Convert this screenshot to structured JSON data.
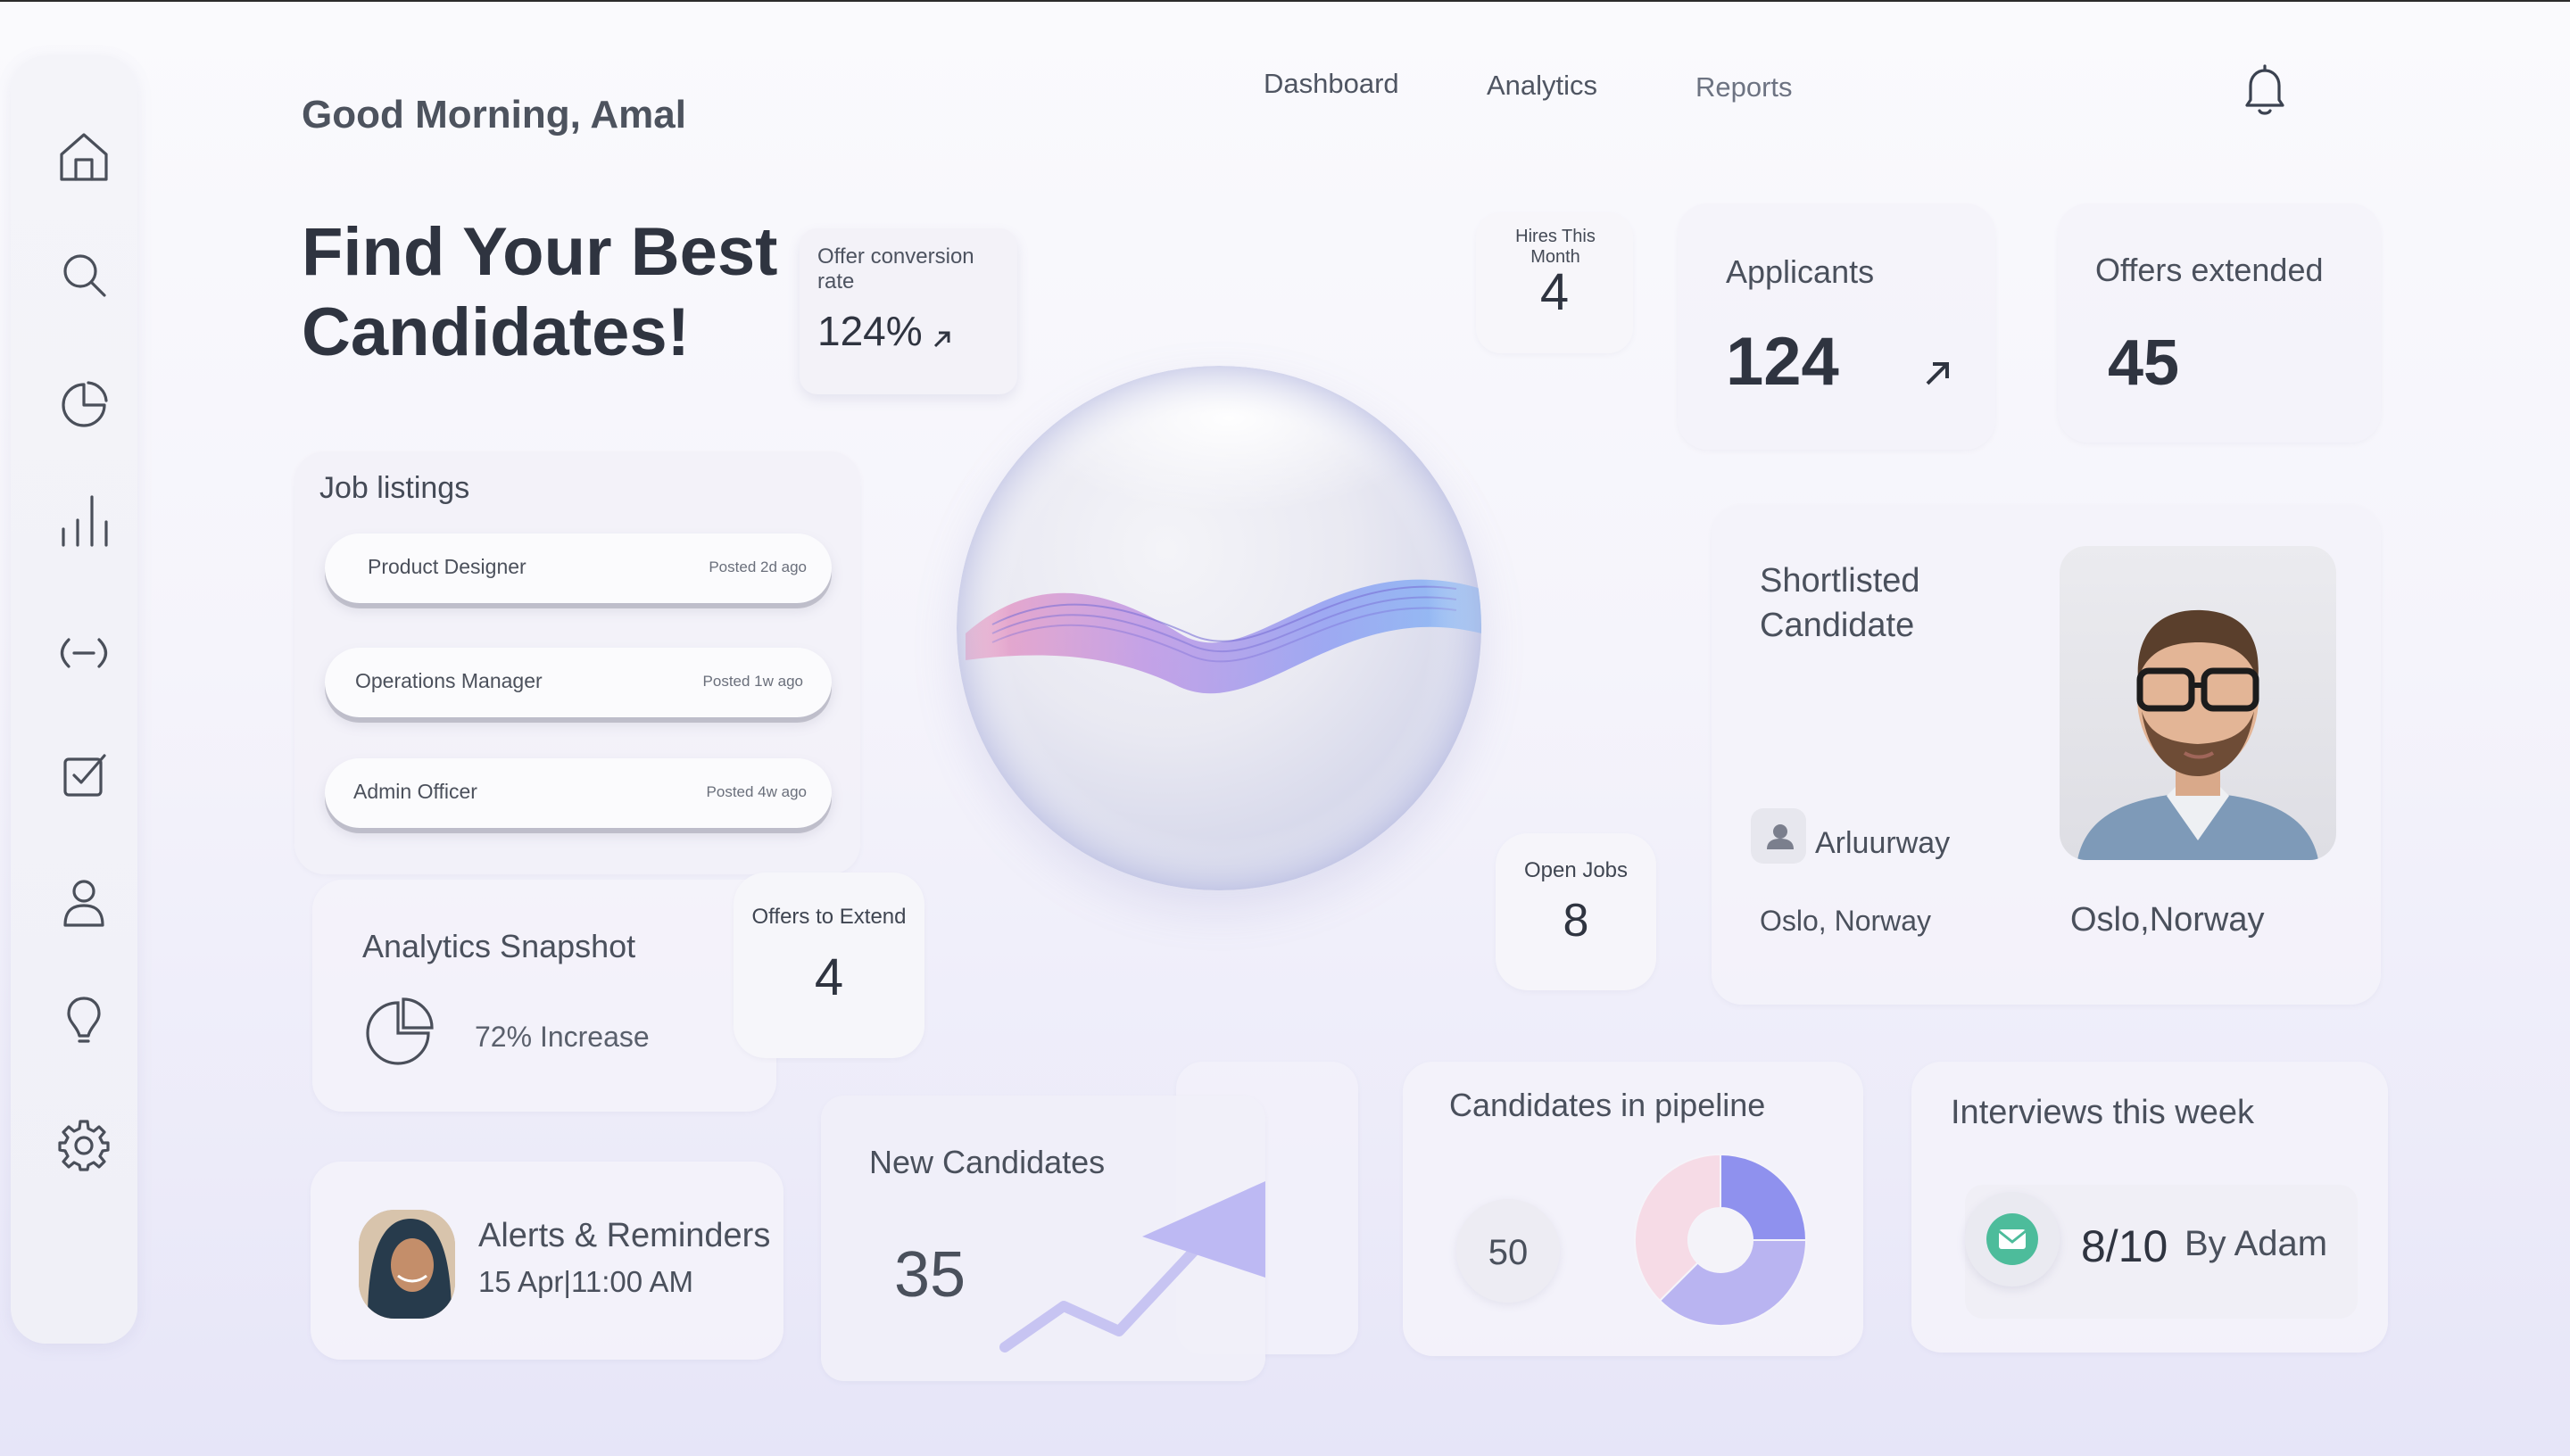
{
  "greeting": "Good Morning, Amal",
  "nav": {
    "items": [
      "Dashboard",
      "Analytics",
      "Reports"
    ]
  },
  "headline": {
    "line1": "Find Your Best",
    "line2": "Candidates!"
  },
  "offer_conversion": {
    "label": "Offer conversion rate",
    "value": "124%"
  },
  "hires_this_month": {
    "label": "Hires This Month",
    "value": "4"
  },
  "applicants": {
    "label": "Applicants",
    "value": "124"
  },
  "offers_extended": {
    "label": "Offers extended",
    "value": "45"
  },
  "job_listings": {
    "title": "Job listings",
    "items": [
      {
        "title": "Product Designer",
        "posted": "Posted 2d ago"
      },
      {
        "title": "Operations Manager",
        "posted": "Posted 1w ago"
      },
      {
        "title": "Admin Officer",
        "posted": "Posted 4w ago"
      }
    ]
  },
  "shortlisted": {
    "title_line1": "Shortlisted",
    "title_line2": "Candidate",
    "name": "Arluurway",
    "location_left": "Oslo, Norway",
    "location_right": "Oslo,Norway"
  },
  "open_jobs": {
    "label": "Open Jobs",
    "value": "8"
  },
  "analytics_snapshot": {
    "title": "Analytics Snapshot",
    "increase": "72% Increase"
  },
  "offers_to_extend": {
    "label": "Offers to Extend",
    "value": "4"
  },
  "alerts": {
    "title": "Alerts & Reminders",
    "datetime": "15 Apr|11:00 AM"
  },
  "new_candidates": {
    "title": "New Candidates",
    "value": "35"
  },
  "pipeline": {
    "title": "Candidates in pipeline",
    "count": "50",
    "chart_data": {
      "type": "pie",
      "segments": [
        {
          "fraction": 0.25,
          "color": "#8f91ee"
        },
        {
          "fraction": 0.375,
          "color": "#b9b4f1"
        },
        {
          "fraction": 0.375,
          "color": "#f6dbe6"
        }
      ]
    }
  },
  "interviews": {
    "title": "Interviews this week",
    "value": "8/10",
    "by": "By Adam"
  },
  "colors": {
    "accent": "#8f91ee",
    "text_dark": "#2f3440",
    "mail_icon": "#4dbc9b"
  },
  "icons": {
    "sidebar": [
      "home-icon",
      "search-icon",
      "pie-chart-icon",
      "bar-chart-icon",
      "link-icon",
      "checkbox-icon",
      "user-icon",
      "lightbulb-icon",
      "settings-icon"
    ],
    "header": "bell-icon"
  }
}
